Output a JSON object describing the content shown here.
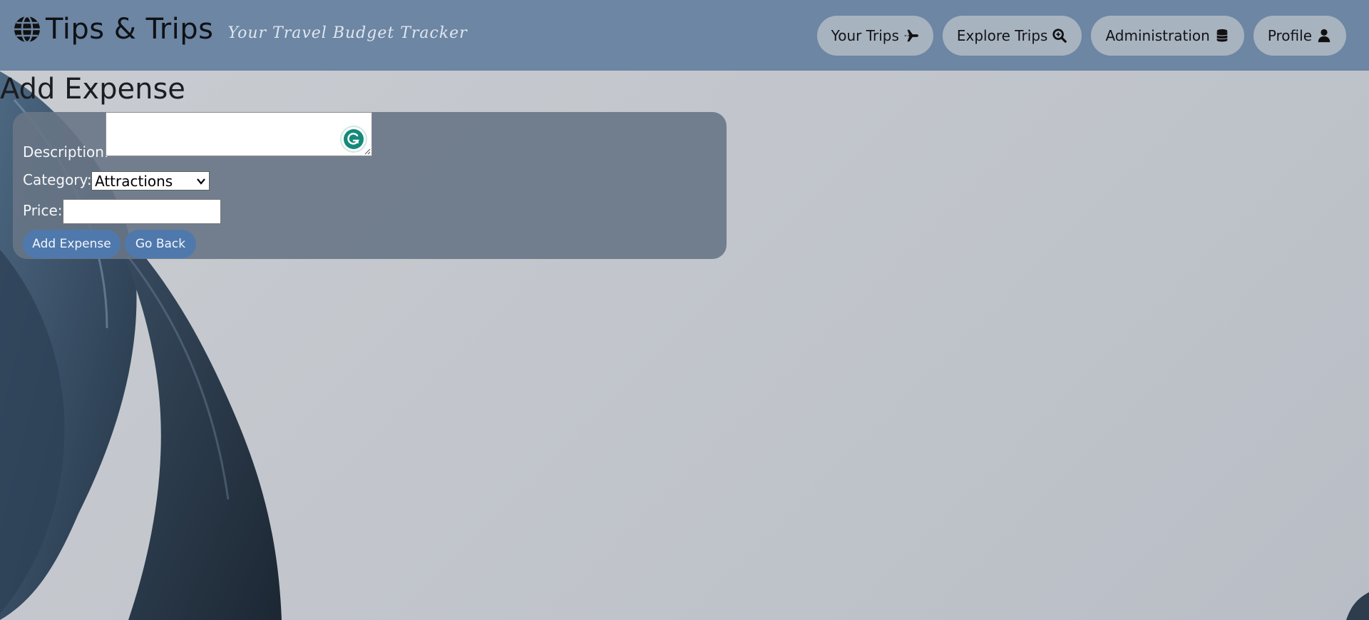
{
  "header": {
    "brand_title": "Tips & Trips",
    "tagline": "Your Travel Budget Tracker",
    "nav": [
      {
        "label": "Your Trips",
        "icon": "plane-icon"
      },
      {
        "label": "Explore Trips",
        "icon": "search-icon"
      },
      {
        "label": "Administration",
        "icon": "database-icon"
      },
      {
        "label": "Profile",
        "icon": "user-icon"
      }
    ]
  },
  "page": {
    "title": "Add Expense"
  },
  "form": {
    "description_label": "Description:",
    "description_value": "",
    "category_label": "Category:",
    "category_value": "Attractions",
    "price_label": "Price:",
    "price_value": "",
    "submit_label": "Add Expense",
    "back_label": "Go Back"
  },
  "colors": {
    "header_bg": "#6c86a3",
    "nav_button_bg": "#a8b3c0",
    "card_bg": "#687686",
    "primary_button": "#4f79ad",
    "grammarly": "#15897a"
  }
}
